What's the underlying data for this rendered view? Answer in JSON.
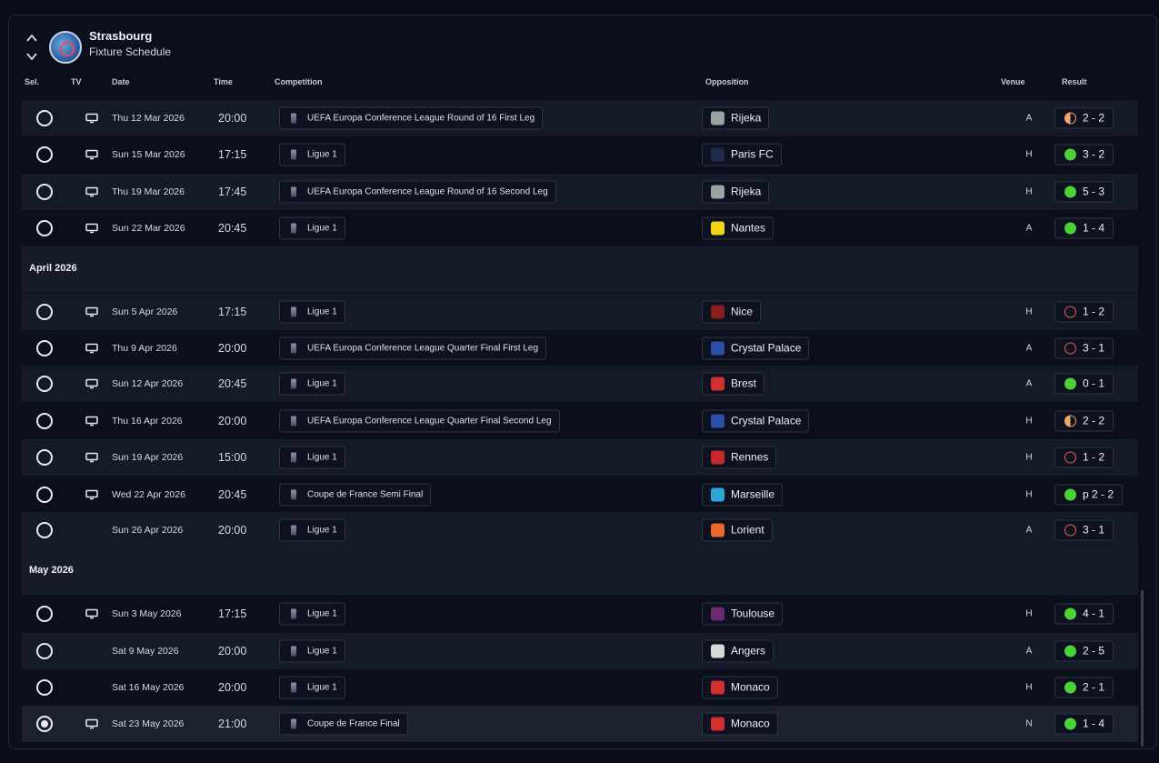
{
  "header": {
    "club": "Strasbourg",
    "subtitle": "Fixture Schedule"
  },
  "columns": {
    "sel": "Sel.",
    "tv": "TV",
    "date": "Date",
    "time": "Time",
    "competition": "Competition",
    "opposition": "Opposition",
    "venue": "Venue",
    "result": "Result"
  },
  "months": [
    "April 2026",
    "May 2026"
  ],
  "fixtures": [
    {
      "tv": true,
      "date": "Thu 12 Mar 2026",
      "time": "20:00",
      "competition": "UEFA Europa Conference League Round of 16  First Leg",
      "opposition": "Rijeka",
      "venue": "A",
      "result": "2 - 2",
      "outcome": "draw",
      "crest": "#9aa3a0"
    },
    {
      "tv": true,
      "date": "Sun 15 Mar 2026",
      "time": "17:15",
      "competition": "Ligue 1",
      "opposition": "Paris FC",
      "venue": "H",
      "result": "3 - 2",
      "outcome": "win",
      "crest": "#1e2b4a"
    },
    {
      "tv": true,
      "date": "Thu 19 Mar 2026",
      "time": "17:45",
      "competition": "UEFA Europa Conference League Round of 16  Second Leg",
      "opposition": "Rijeka",
      "venue": "H",
      "result": "5 - 3",
      "outcome": "win",
      "crest": "#9aa3a0"
    },
    {
      "tv": true,
      "date": "Sun 22 Mar 2026",
      "time": "20:45",
      "competition": "Ligue 1",
      "opposition": "Nantes",
      "venue": "A",
      "result": "1 - 4",
      "outcome": "win",
      "crest": "#f2d41a"
    },
    {
      "tv": true,
      "date": "Sun 5 Apr 2026",
      "time": "17:15",
      "competition": "Ligue 1",
      "opposition": "Nice",
      "venue": "H",
      "result": "1 - 2",
      "outcome": "loss",
      "crest": "#8a1c1c"
    },
    {
      "tv": true,
      "date": "Thu 9 Apr 2026",
      "time": "20:00",
      "competition": "UEFA Europa Conference League Quarter Final First Leg",
      "opposition": "Crystal Palace",
      "venue": "A",
      "result": "3 - 1",
      "outcome": "loss",
      "crest": "#2a4fa8"
    },
    {
      "tv": true,
      "date": "Sun 12 Apr 2026",
      "time": "20:45",
      "competition": "Ligue 1",
      "opposition": "Brest",
      "venue": "A",
      "result": "0 - 1",
      "outcome": "win",
      "crest": "#d32f2f"
    },
    {
      "tv": true,
      "date": "Thu 16 Apr 2026",
      "time": "20:00",
      "competition": "UEFA Europa Conference League Quarter Final Second Leg",
      "opposition": "Crystal Palace",
      "venue": "H",
      "result": "2 - 2",
      "outcome": "draw",
      "crest": "#2a4fa8"
    },
    {
      "tv": true,
      "date": "Sun 19 Apr 2026",
      "time": "15:00",
      "competition": "Ligue 1",
      "opposition": "Rennes",
      "venue": "H",
      "result": "1 - 2",
      "outcome": "loss",
      "crest": "#c62828"
    },
    {
      "tv": true,
      "date": "Wed 22 Apr 2026",
      "time": "20:45",
      "competition": "Coupe de France Semi Final",
      "opposition": "Marseille",
      "venue": "H",
      "result": "p 2 - 2",
      "outcome": "win",
      "crest": "#2aa6d9"
    },
    {
      "tv": false,
      "date": "Sun 26 Apr 2026",
      "time": "20:00",
      "competition": "Ligue 1",
      "opposition": "Lorient",
      "venue": "A",
      "result": "3 - 1",
      "outcome": "loss",
      "crest": "#e8692a"
    },
    {
      "tv": true,
      "date": "Sun 3 May 2026",
      "time": "17:15",
      "competition": "Ligue 1",
      "opposition": "Toulouse",
      "venue": "H",
      "result": "4 - 1",
      "outcome": "win",
      "crest": "#6b2a6e"
    },
    {
      "tv": false,
      "date": "Sat 9 May 2026",
      "time": "20:00",
      "competition": "Ligue 1",
      "opposition": "Angers",
      "venue": "A",
      "result": "2 - 5",
      "outcome": "win",
      "crest": "#d9d9d9"
    },
    {
      "tv": false,
      "date": "Sat 16 May 2026",
      "time": "20:00",
      "competition": "Ligue 1",
      "opposition": "Monaco",
      "venue": "H",
      "result": "2 - 1",
      "outcome": "win",
      "crest": "#d32f2f"
    },
    {
      "tv": true,
      "date": "Sat 23 May 2026",
      "time": "21:00",
      "competition": "Coupe de France Final",
      "opposition": "Monaco",
      "venue": "N",
      "result": "1 - 4",
      "outcome": "win",
      "crest": "#d32f2f",
      "selected": true
    }
  ]
}
